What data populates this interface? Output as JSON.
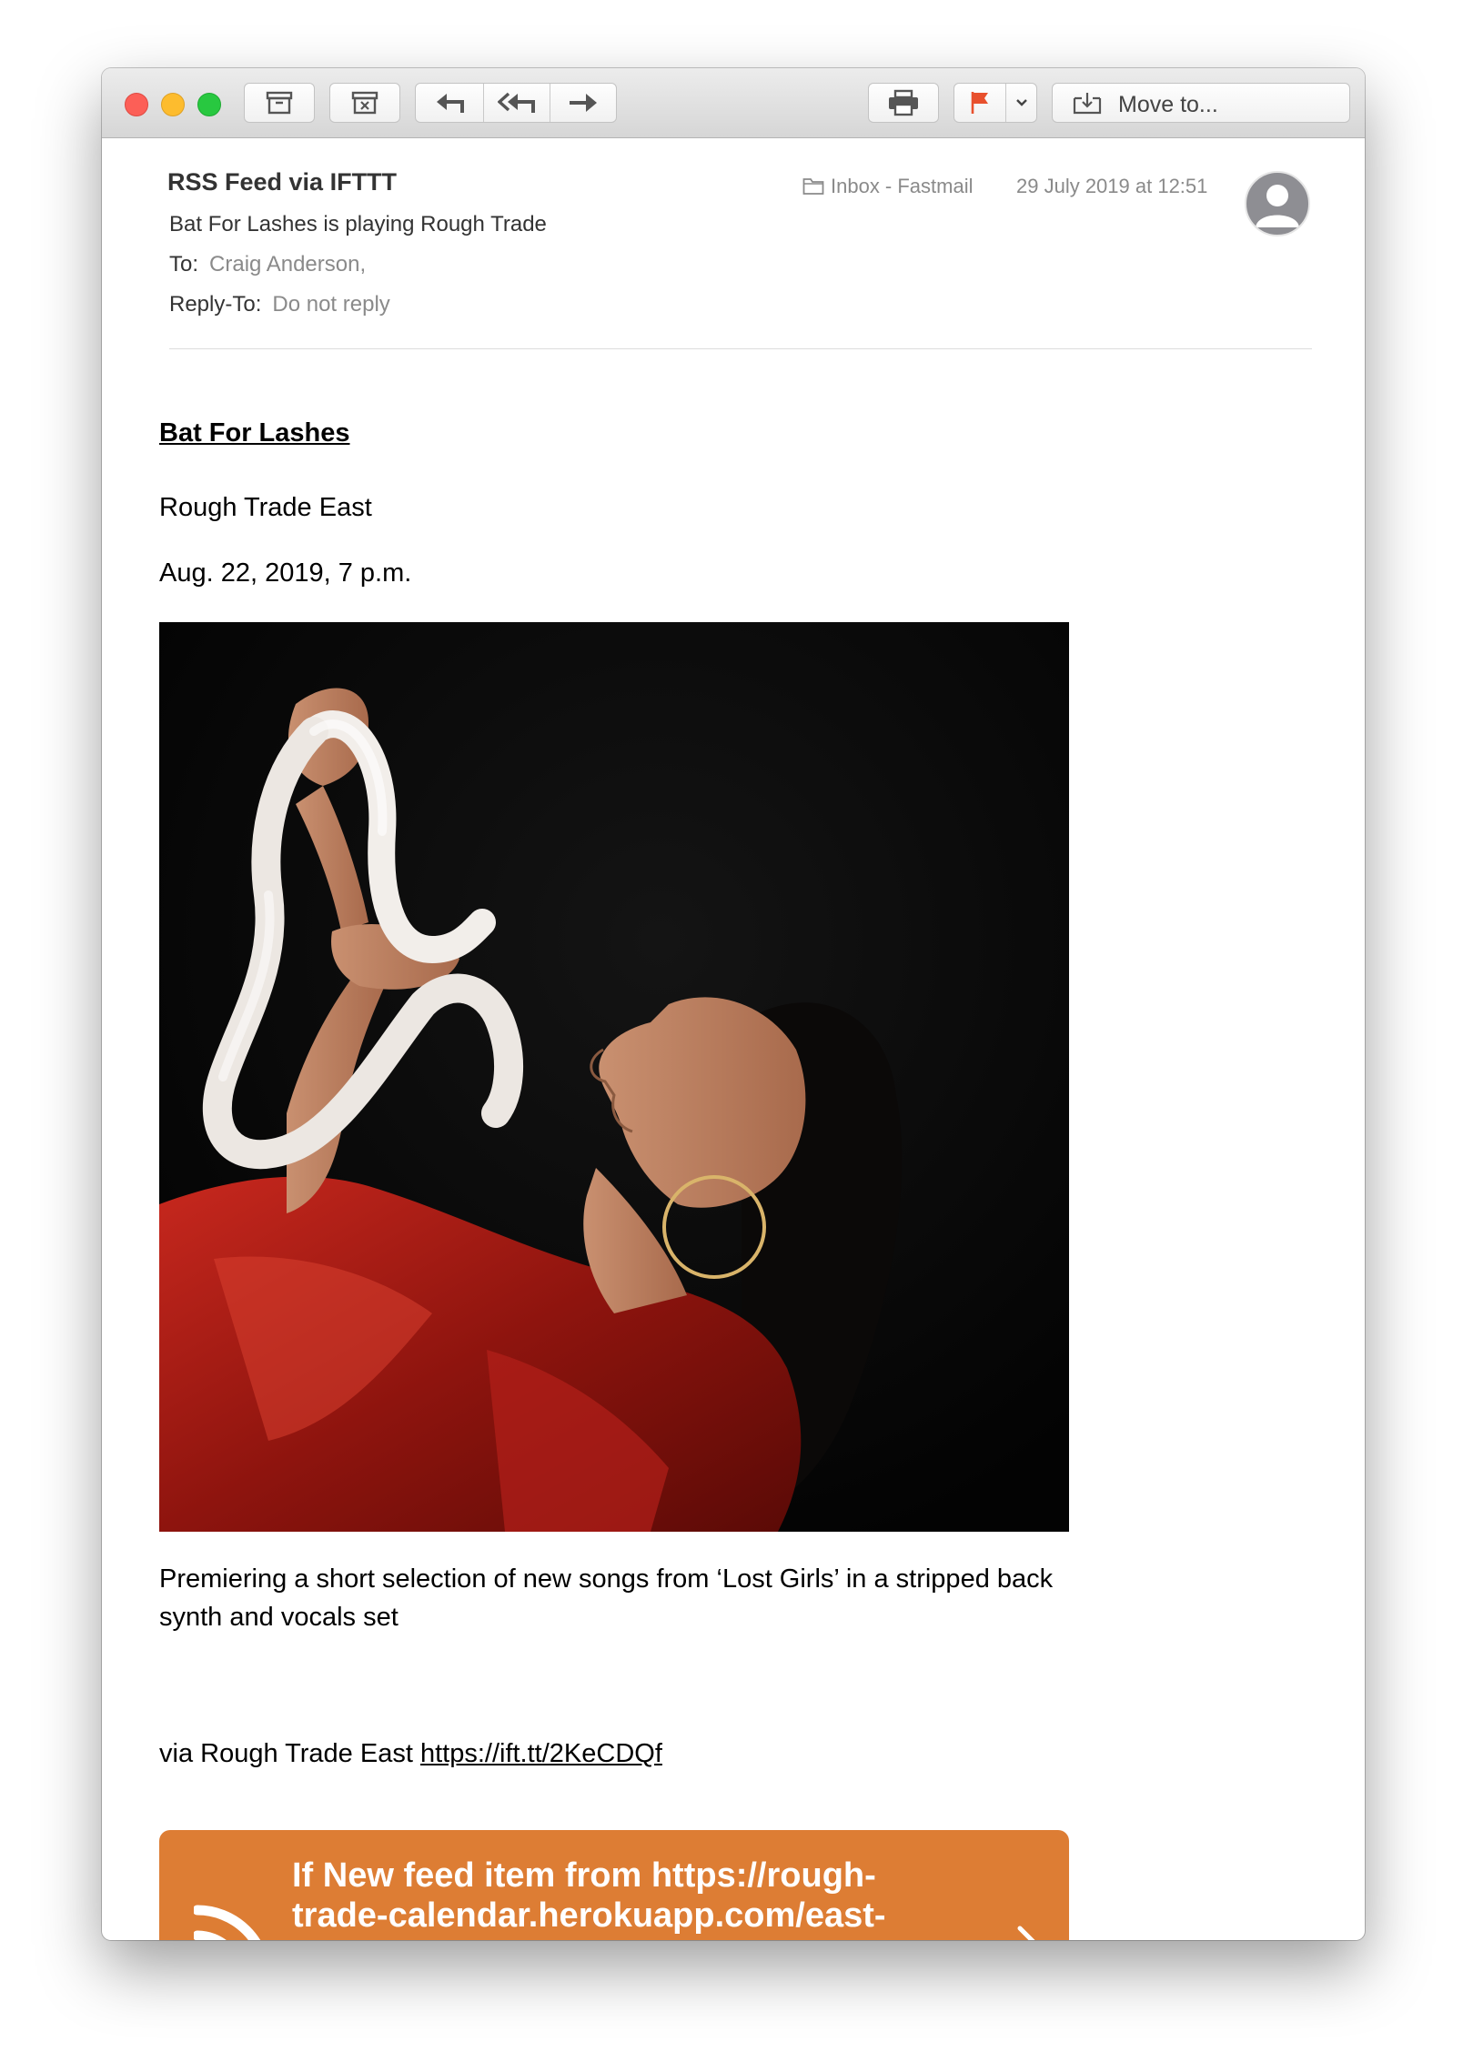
{
  "toolbar": {
    "archive_icon": "archive-icon",
    "junk_icon": "junk-icon",
    "reply_icon": "reply-icon",
    "reply_all_icon": "reply-all-icon",
    "forward_icon": "forward-icon",
    "print_icon": "printer-icon",
    "flag_icon": "flag-icon",
    "flag_color": "#e8502d",
    "move_to_label": "Move to..."
  },
  "message": {
    "from": "RSS Feed via IFTTT",
    "subject": "Bat For Lashes is playing Rough Trade",
    "to_label": "To:",
    "to_value": "Craig Anderson,",
    "reply_to_label": "Reply-To:",
    "reply_to_value": "Do not reply",
    "mailbox": "Inbox - Fastmail",
    "date": "29 July 2019 at 12:51"
  },
  "content": {
    "event_title": "Bat For Lashes",
    "venue": "Rough Trade East",
    "when": "Aug. 22, 2019, 7 p.m.",
    "description": "Premiering a short selection of new songs from ‘Lost Girls’ in a stripped back synth and vocals set",
    "via_prefix": "via Rough Trade East",
    "via_link": "https://ift.tt/2KeCDQf",
    "applet_text": "If New feed item from https://rough-trade-calendar.herokuapp.com/east-",
    "applet_color": "#dd7d34"
  }
}
